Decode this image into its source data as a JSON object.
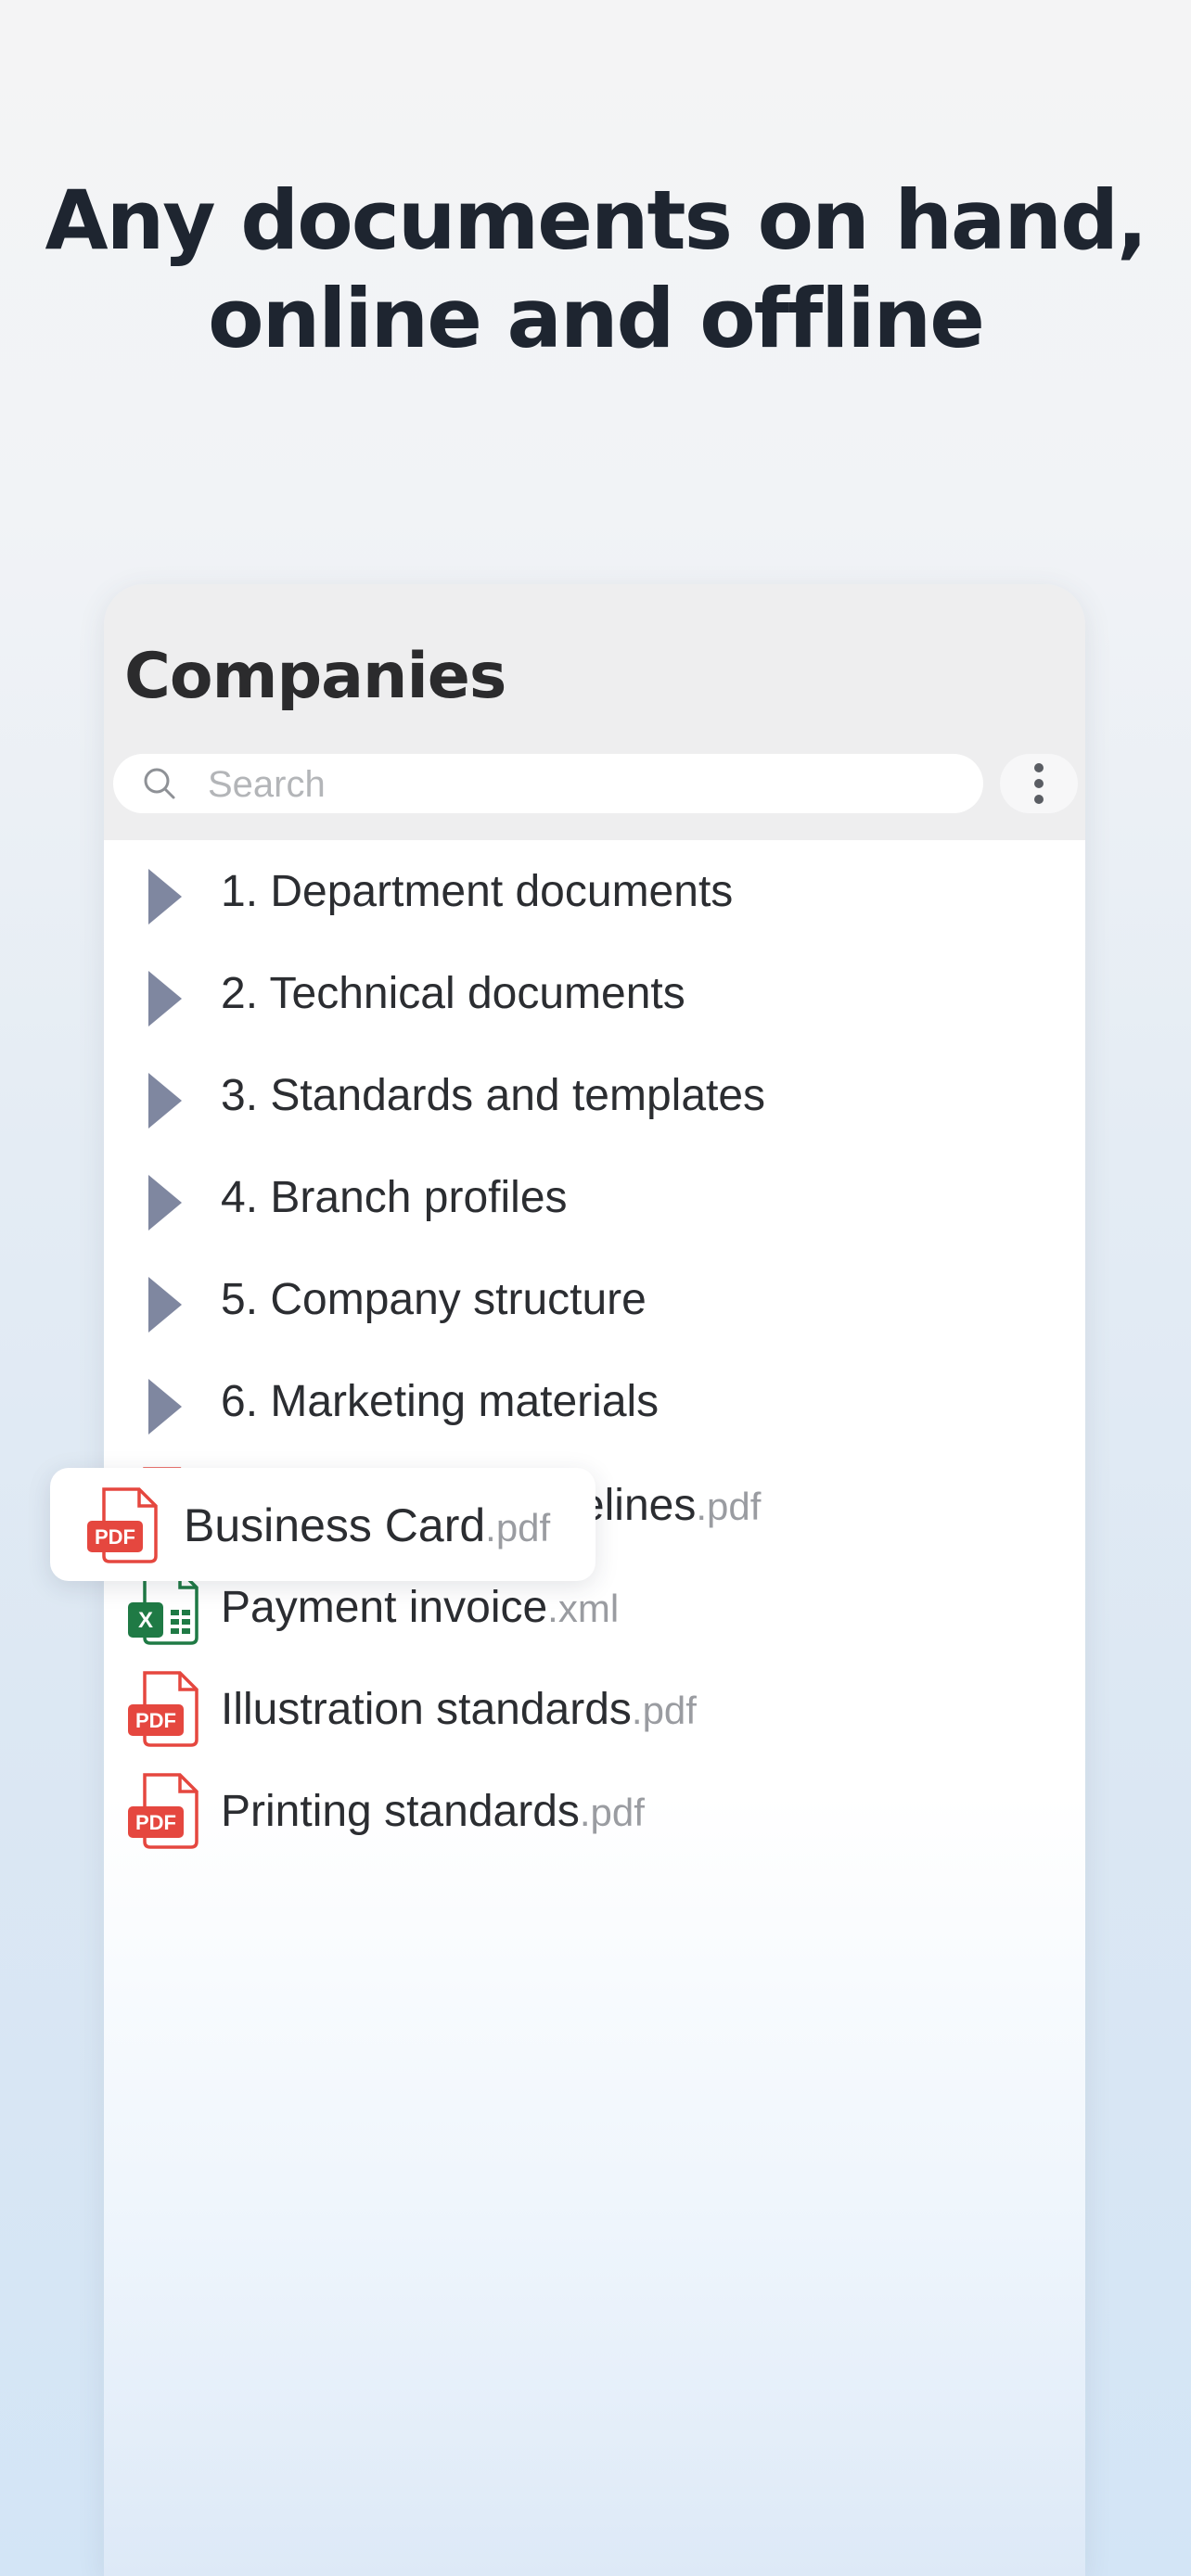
{
  "headline": {
    "line1": "Any documents on hand,",
    "line2": "online and offline"
  },
  "panel": {
    "title": "Companies",
    "search_placeholder": "Search"
  },
  "folders": [
    {
      "label": "1. Department documents"
    },
    {
      "label": "2. Technical documents"
    },
    {
      "label": "3. Standards and templates"
    },
    {
      "label": "4. Branch profiles"
    },
    {
      "label": "5. Company structure"
    },
    {
      "label": "6. Marketing materials"
    }
  ],
  "dragged_file": {
    "name": "Business Card",
    "ext": ".pdf",
    "icon": "pdf-file-icon"
  },
  "files": [
    {
      "name": "Logo. Usage Guidelines",
      "ext": ".pdf",
      "icon": "pdf-file-icon"
    },
    {
      "name": "Payment invoice",
      "ext": ".xml",
      "icon": "excel-file-icon"
    },
    {
      "name": "Illustration standards",
      "ext": ".pdf",
      "icon": "pdf-file-icon"
    },
    {
      "name": "Printing standards",
      "ext": ".pdf",
      "icon": "pdf-file-icon"
    }
  ],
  "colors": {
    "pdf_red": "#e5473f",
    "excel_green": "#1f7a45",
    "folder_arrow": "#7f87a0"
  }
}
